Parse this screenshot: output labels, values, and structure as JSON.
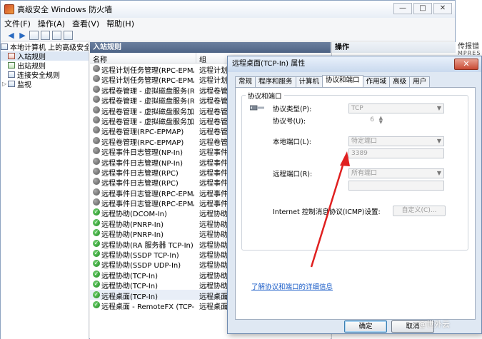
{
  "window": {
    "title": "高级安全 Windows 防火墙",
    "min": "—",
    "max": "□",
    "close": "✕"
  },
  "menu": [
    "文件(F)",
    "操作(A)",
    "查看(V)",
    "帮助(H)"
  ],
  "tree": {
    "root": "本地计算机 上的高级安全",
    "items": [
      "入站规则",
      "出站规则",
      "连接安全规则",
      "监视"
    ]
  },
  "list": {
    "header": "入站规则",
    "col_name": "名称",
    "col_group": "组",
    "rules": [
      {
        "name": "远程计划任务管理(RPC-EPMAP)",
        "group": "远程计划",
        "enabled": false
      },
      {
        "name": "远程计划任务管理(RPC-EPMAP)",
        "group": "远程计划",
        "enabled": false
      },
      {
        "name": "远程卷管理 - 虚拟磁盘服务(RPC)",
        "group": "远程卷管",
        "enabled": false
      },
      {
        "name": "远程卷管理 - 虚拟磁盘服务(RPC)",
        "group": "远程卷管",
        "enabled": false
      },
      {
        "name": "远程卷管理 - 虚拟磁盘服务加载...",
        "group": "远程卷管",
        "enabled": false
      },
      {
        "name": "远程卷管理 - 虚拟磁盘服务加载...",
        "group": "远程卷管",
        "enabled": false
      },
      {
        "name": "远程卷管理(RPC-EPMAP)",
        "group": "远程卷管",
        "enabled": false
      },
      {
        "name": "远程卷管理(RPC-EPMAP)",
        "group": "远程卷管",
        "enabled": false
      },
      {
        "name": "远程事件日志管理(NP-In)",
        "group": "远程事件",
        "enabled": false
      },
      {
        "name": "远程事件日志管理(NP-In)",
        "group": "远程事件",
        "enabled": false
      },
      {
        "name": "远程事件日志管理(RPC)",
        "group": "远程事件",
        "enabled": false
      },
      {
        "name": "远程事件日志管理(RPC)",
        "group": "远程事件",
        "enabled": false
      },
      {
        "name": "远程事件日志管理(RPC-EPMAP)",
        "group": "远程事件",
        "enabled": false
      },
      {
        "name": "远程事件日志管理(RPC-EPMAP)",
        "group": "远程事件",
        "enabled": false
      },
      {
        "name": "远程协助(DCOM-In)",
        "group": "远程协助",
        "enabled": true
      },
      {
        "name": "远程协助(PNRP-In)",
        "group": "远程协助",
        "enabled": true
      },
      {
        "name": "远程协助(PNRP-In)",
        "group": "远程协助",
        "enabled": true
      },
      {
        "name": "远程协助(RA 服务器 TCP-In)",
        "group": "远程协助",
        "enabled": true
      },
      {
        "name": "远程协助(SSDP TCP-In)",
        "group": "远程协助",
        "enabled": true
      },
      {
        "name": "远程协助(SSDP UDP-In)",
        "group": "远程协助",
        "enabled": true
      },
      {
        "name": "远程协助(TCP-In)",
        "group": "远程协助",
        "enabled": true
      },
      {
        "name": "远程协助(TCP-In)",
        "group": "远程协助",
        "enabled": true
      },
      {
        "name": "远程桌面(TCP-In)",
        "group": "远程桌面",
        "enabled": true
      },
      {
        "name": "远程桌面 - RemoteFX (TCP-In)",
        "group": "远程桌面",
        "enabled": true
      }
    ]
  },
  "actions": {
    "header": "操作"
  },
  "background": {
    "text1": "传报错",
    "text2": "MPRES"
  },
  "dialog": {
    "title": "远程桌面(TCP-In) 属性",
    "close": "✕",
    "tabs": [
      "常规",
      "程序和服务",
      "计算机",
      "协议和端口",
      "作用域",
      "高级",
      "用户"
    ],
    "group_label": "协议和端口",
    "protocol_type_label": "协议类型(P):",
    "protocol_type_value": "TCP",
    "protocol_number_label": "协议号(U):",
    "protocol_number_value": "6",
    "local_port_label": "本地端口(L):",
    "local_port_value": "特定端口",
    "local_port_number": "3389",
    "remote_port_label": "远程端口(R):",
    "remote_port_value": "所有端口",
    "icmp_label": "Internet 控制消息协议(ICMP)设置:",
    "icmp_button": "自定义(C)...",
    "link": "了解协议和端口的详细信息",
    "ok": "确定",
    "cancel": "取消"
  },
  "watermark": "@世外云"
}
